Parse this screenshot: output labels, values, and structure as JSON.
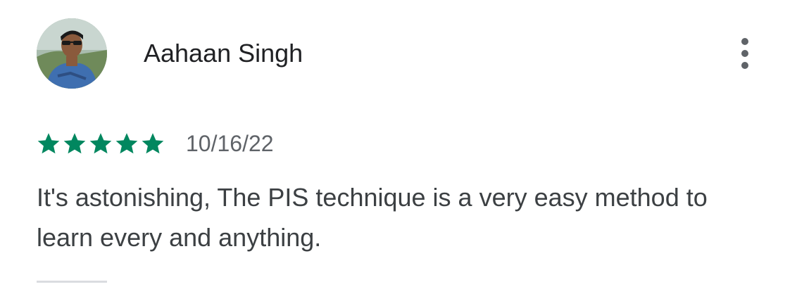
{
  "review": {
    "author_name": "Aahaan Singh",
    "rating": 5,
    "rating_max": 5,
    "date": "10/16/22",
    "text": "It's astonishing, The PIS technique is a very easy method to learn every and anything."
  },
  "icons": {
    "avatar": "user-photo",
    "star": "star-filled-icon",
    "more": "more-vert-icon"
  },
  "colors": {
    "star": "#01875f",
    "author": "#202124",
    "date": "#5f6368",
    "text": "#3c4043",
    "menu_dots": "#5f6368",
    "divider": "#dadce0"
  }
}
